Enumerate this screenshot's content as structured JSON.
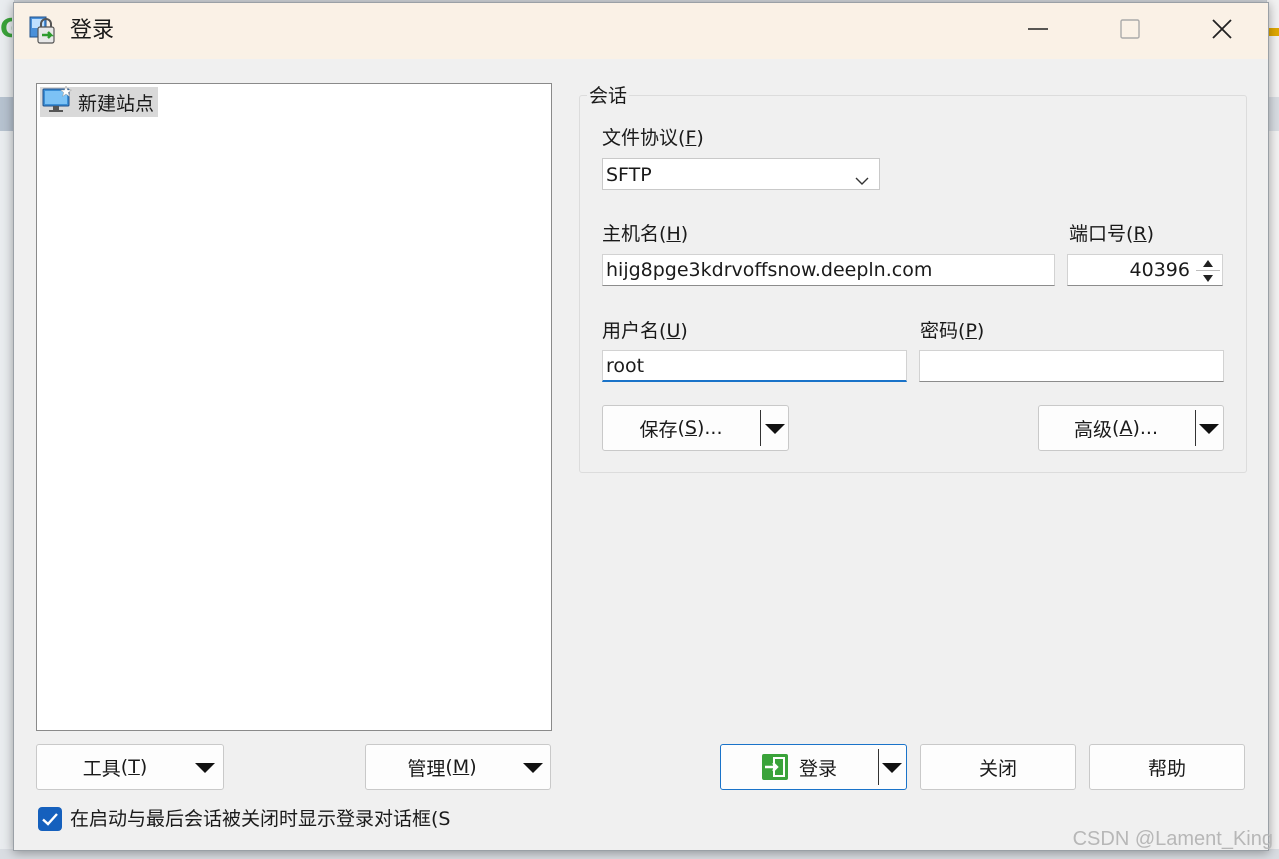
{
  "window": {
    "title": "登录",
    "icon": "login-app-icon",
    "minimize_icon": "minimize-icon",
    "maximize_icon": "maximize-icon",
    "close_icon": "close-icon"
  },
  "site_tree": {
    "items": [
      {
        "label": "新建站点",
        "icon": "new-site-monitor-icon"
      }
    ]
  },
  "bottom_left": {
    "tools_label": "工具",
    "tools_key": "T",
    "manage_label": "管理",
    "manage_key": "M",
    "checkbox_checked": true,
    "checkbox_label": "在启动与最后会话被关闭时显示登录对话框(S"
  },
  "session": {
    "legend": "会话",
    "protocol": {
      "label": "文件协议",
      "key": "F",
      "value": "SFTP"
    },
    "host": {
      "label": "主机名",
      "key": "H",
      "value": "hijg8pge3kdrvoffsnow.deepln.com"
    },
    "port": {
      "label": "端口号",
      "key": "R",
      "value": "40396"
    },
    "username": {
      "label": "用户名",
      "key": "U",
      "value": "root"
    },
    "password": {
      "label": "密码",
      "key": "P",
      "value": ""
    },
    "save_button": {
      "label": "保存",
      "key": "S",
      "suffix": "..."
    },
    "advanced_button": {
      "label": "高级",
      "key": "A",
      "suffix": "..."
    }
  },
  "actions": {
    "login_label": "登录",
    "login_icon": "login-arrow-icon",
    "close_label": "关闭",
    "help_label": "帮助"
  },
  "watermark": "CSDN @Lament_King",
  "colors": {
    "accent": "#1a73c9",
    "checkbox": "#1560bd",
    "titlebar": "#faf1e6"
  }
}
